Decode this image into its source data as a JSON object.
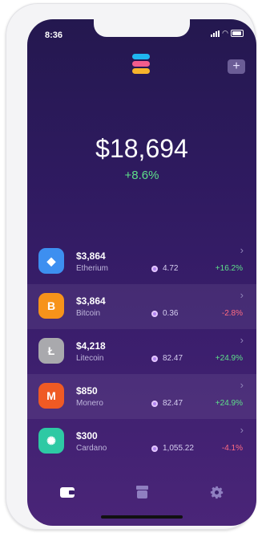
{
  "status_bar": {
    "time": "8:36"
  },
  "header": {
    "add_icon": "plus-icon",
    "logo_colors": [
      "#1fb6f0",
      "#f25c8c",
      "#f7b42c"
    ]
  },
  "portfolio": {
    "balance": "$18,694",
    "change": "+8.6%"
  },
  "coins": [
    {
      "name": "Etherium",
      "value": "$3,864",
      "holdings": "4.72",
      "change": "+16.2%",
      "change_color": "#5ee08a",
      "icon": "ethereum-icon",
      "icon_glyph": "◆",
      "icon_color": "#3d8ff0"
    },
    {
      "name": "Bitcoin",
      "value": "$3,864",
      "holdings": "0.36",
      "change": "-2.8%",
      "change_color": "#ff6b81",
      "icon": "bitcoin-icon",
      "icon_glyph": "B",
      "icon_color": "#f7931a"
    },
    {
      "name": "Litecoin",
      "value": "$4,218",
      "holdings": "82.47",
      "change": "+24.9%",
      "change_color": "#5ee08a",
      "icon": "litecoin-icon",
      "icon_glyph": "Ł",
      "icon_color": "#a9a9ad"
    },
    {
      "name": "Monero",
      "value": "$850",
      "holdings": "82.47",
      "change": "+24.9%",
      "change_color": "#5ee08a",
      "icon": "monero-icon",
      "icon_glyph": "M",
      "icon_color": "#ef5a24"
    },
    {
      "name": "Cardano",
      "value": "$300",
      "holdings": "1,055.22",
      "change": "-4.1%",
      "change_color": "#ff6b81",
      "icon": "cardano-icon",
      "icon_glyph": "✺",
      "icon_color": "#2ec9a4"
    }
  ],
  "tab_bar": {
    "items": [
      "wallet-icon",
      "store-icon",
      "gear-icon"
    ]
  }
}
